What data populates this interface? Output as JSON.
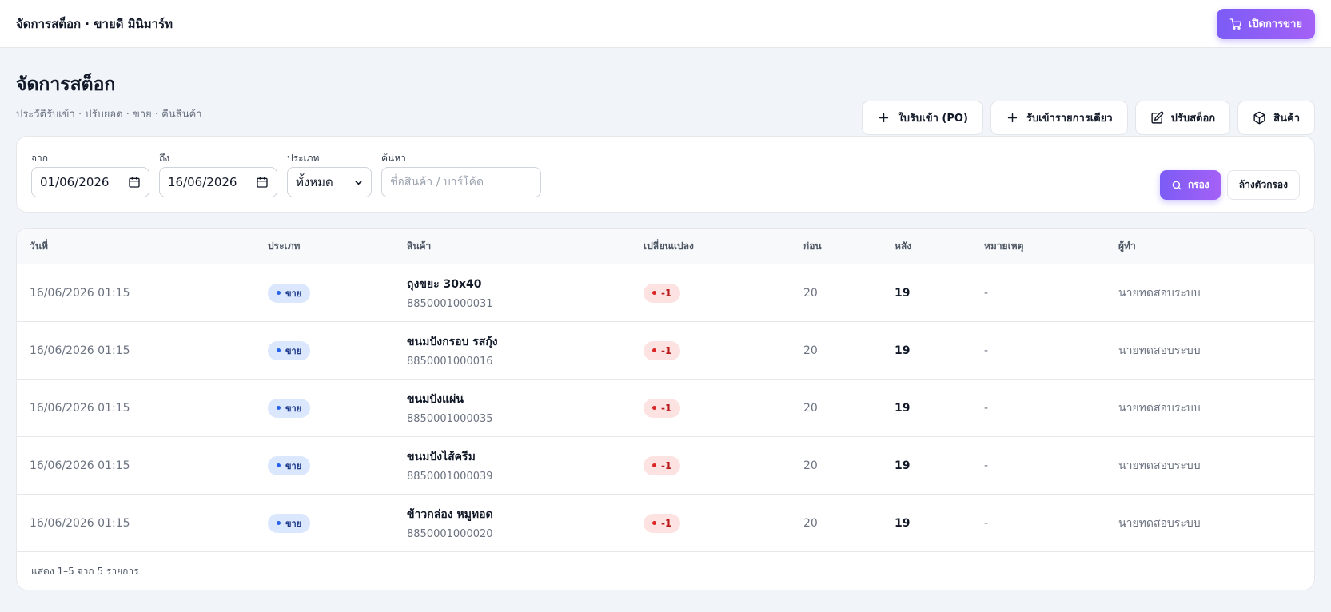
{
  "header": {
    "app_title": "จัดการสต็อก · ขายดี มินิมาร์ท",
    "open_sale_label": "เปิดการขาย"
  },
  "page": {
    "title": "จัดการสต็อก",
    "subtitle": "ประวัติรับเข้า · ปรับยอด · ขาย · คืนสินค้า"
  },
  "actions": {
    "po_label": "ใบรับเข้า (PO)",
    "receive_single_label": "รับเข้ารายการเดียว",
    "adjust_label": "ปรับสต็อก",
    "products_label": "สินค้า"
  },
  "filters": {
    "from_label": "จาก",
    "from_value": "01/06/2026",
    "to_label": "ถึง",
    "to_value": "16/06/2026",
    "type_label": "ประเภท",
    "type_value": "ทั้งหมด",
    "search_label": "ค้นหา",
    "search_placeholder": "ชื่อสินค้า / บาร์โค้ด",
    "filter_button": "กรอง",
    "clear_button": "ล้างตัวกรอง"
  },
  "table": {
    "columns": [
      "วันที่",
      "ประเภท",
      "สินค้า",
      "เปลี่ยนแปลง",
      "ก่อน",
      "หลัง",
      "หมายเหตุ",
      "ผู้ทำ"
    ],
    "rows": [
      {
        "date": "16/06/2026 01:15",
        "type": "ขาย",
        "product": "ถุงขยะ 30x40",
        "barcode": "8850001000031",
        "change": "-1",
        "before": "20",
        "after": "19",
        "note": "-",
        "user": "นายทดสอบระบบ"
      },
      {
        "date": "16/06/2026 01:15",
        "type": "ขาย",
        "product": "ขนมปังกรอบ รสกุ้ง",
        "barcode": "8850001000016",
        "change": "-1",
        "before": "20",
        "after": "19",
        "note": "-",
        "user": "นายทดสอบระบบ"
      },
      {
        "date": "16/06/2026 01:15",
        "type": "ขาย",
        "product": "ขนมปังแผ่น",
        "barcode": "8850001000035",
        "change": "-1",
        "before": "20",
        "after": "19",
        "note": "-",
        "user": "นายทดสอบระบบ"
      },
      {
        "date": "16/06/2026 01:15",
        "type": "ขาย",
        "product": "ขนมปังไส้ครีม",
        "barcode": "8850001000039",
        "change": "-1",
        "before": "20",
        "after": "19",
        "note": "-",
        "user": "นายทดสอบระบบ"
      },
      {
        "date": "16/06/2026 01:15",
        "type": "ขาย",
        "product": "ข้าวกล่อง หมูทอด",
        "barcode": "8850001000020",
        "change": "-1",
        "before": "20",
        "after": "19",
        "note": "-",
        "user": "นายทดสอบระบบ"
      }
    ],
    "footer": "แสดง 1–5 จาก 5 รายการ"
  },
  "colors": {
    "accent": "#7c5cf6",
    "accent_end": "#a461f6",
    "type_badge_bg": "#dbe7fd",
    "change_badge_bg": "#fde2e2",
    "page_bg": "#f1f4f9"
  },
  "icons": {
    "open_sale": "cart-icon",
    "po": "plus-icon",
    "receive_single": "plus-icon",
    "adjust": "edit-icon",
    "products": "box-icon",
    "date": "calendar-icon",
    "select": "chevron-down-icon",
    "filter": "search-icon"
  }
}
